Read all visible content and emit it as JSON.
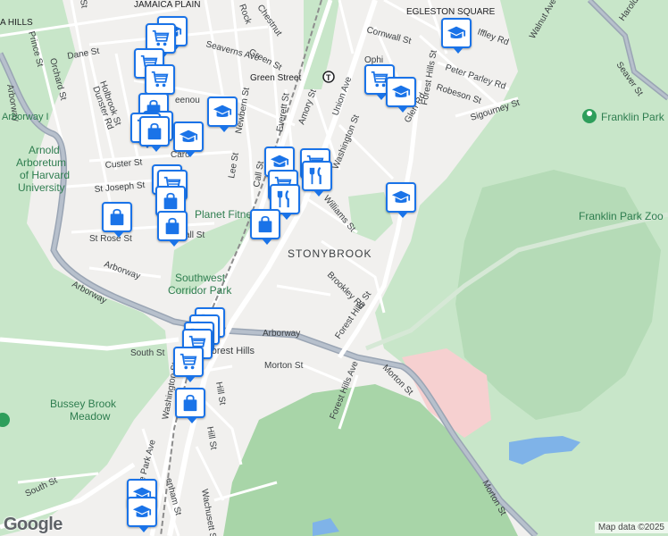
{
  "map": {
    "neighborhood_labels": {
      "stonybrook": "STONYBROOK",
      "jamaica_plain": "JAMAICA PLAIN",
      "hills": "A HILLS",
      "egleston": "EGLESTON SQUARE"
    },
    "parks": {
      "arnold_arboretum": [
        "Arnold",
        "Arboretum",
        "of Harvard",
        "University"
      ],
      "franklin_park": "Franklin Park",
      "franklin_park_zoo": "Franklin Park Zoo",
      "southwest_corridor": [
        "Southwest",
        "Corridor Park"
      ],
      "bussey_brook": [
        "Bussey Brook",
        "Meadow"
      ],
      "planet_fitness": "Planet Fitness"
    },
    "transit": {
      "green_street": "Green Street"
    },
    "streets": {
      "arborway_nw": "Arborway",
      "arborway_w": "Arborway",
      "arborway_w2": "Arborway",
      "arborway_c": "Arborway",
      "arborway_n": "Arborway I",
      "morton_st_1": "Morton St",
      "morton_st_2": "Morton St",
      "morton_st_3": "Morton St",
      "forest_hills_st": "Forest Hills St",
      "forest_hills_st_n": "Forest Hills St",
      "forest_hills_ave": "Forest Hills Ave",
      "forest_hills": "Forest Hills",
      "washington_st_n": "Washington St",
      "washington_st_s": "Washington St",
      "williams_st": "Williams St",
      "brookley_rd": "Brookley Rd",
      "south_st": "South St",
      "south_st_2": "South St",
      "green_st": "Green St",
      "seaverns_ave": "Seaverns Ave",
      "amory_st": "Amory St",
      "union_ave": "Union Ave",
      "everett_st": "Everett St",
      "newbern_st": "Newbern St",
      "call_st": "Call St",
      "lee_st": "Lee St",
      "custer_st": "Custer St",
      "st_joseph_st": "St Joseph St",
      "st_rose_st": "St Rose St",
      "hall_st": "all St",
      "carolina_ave": "Caro",
      "greenough": "eenou",
      "dane_st": "Dane St",
      "holbrook_st": "Holbrook St",
      "dunster_rd": "Dunster Rd",
      "orchard_st": "Orchard St",
      "prince_st": "Prince St",
      "chestnut": "Chestnut",
      "rock": "Rock",
      "cornwall_st": "Cornwall St",
      "iffley_rd": "Iffley Rd",
      "walnut_ave": "Walnut Ave",
      "harold": "Harold",
      "seaver_st": "Seaver St",
      "peter_parley_rd": "Peter Parley Rd",
      "robeson_st": "Robeson St",
      "sigourney_st": "Sigourney St",
      "glen_rd": "Glen Rd",
      "ophir": "Ophi",
      "hill_st": "Hill St",
      "hill_st_2": "Hill St",
      "wachusett_st": "Wachusett St",
      "hyde_park_ave": "de Park Ave",
      "brenham": "enham St",
      "top_st": "St"
    }
  },
  "pins": [
    {
      "type": "school",
      "icon": "school-icon"
    },
    {
      "type": "grocery",
      "icon": "shopping-cart-icon"
    },
    {
      "type": "shopping",
      "icon": "shopping-bag-icon"
    },
    {
      "type": "restaurant",
      "icon": "restaurant-icon"
    }
  ],
  "footer": {
    "google_logo": "Google",
    "attribution": "Map data ©2025"
  },
  "colors": {
    "background": "#f1f0ee",
    "park": "#c8e6c9",
    "park_dark": "#a8d5a8",
    "water": "#7fb3e8",
    "road_major": "#9aa5b4",
    "road_minor": "#ffffff",
    "hospital": "#f6d0d0",
    "pin_border": "#1a73e8"
  }
}
